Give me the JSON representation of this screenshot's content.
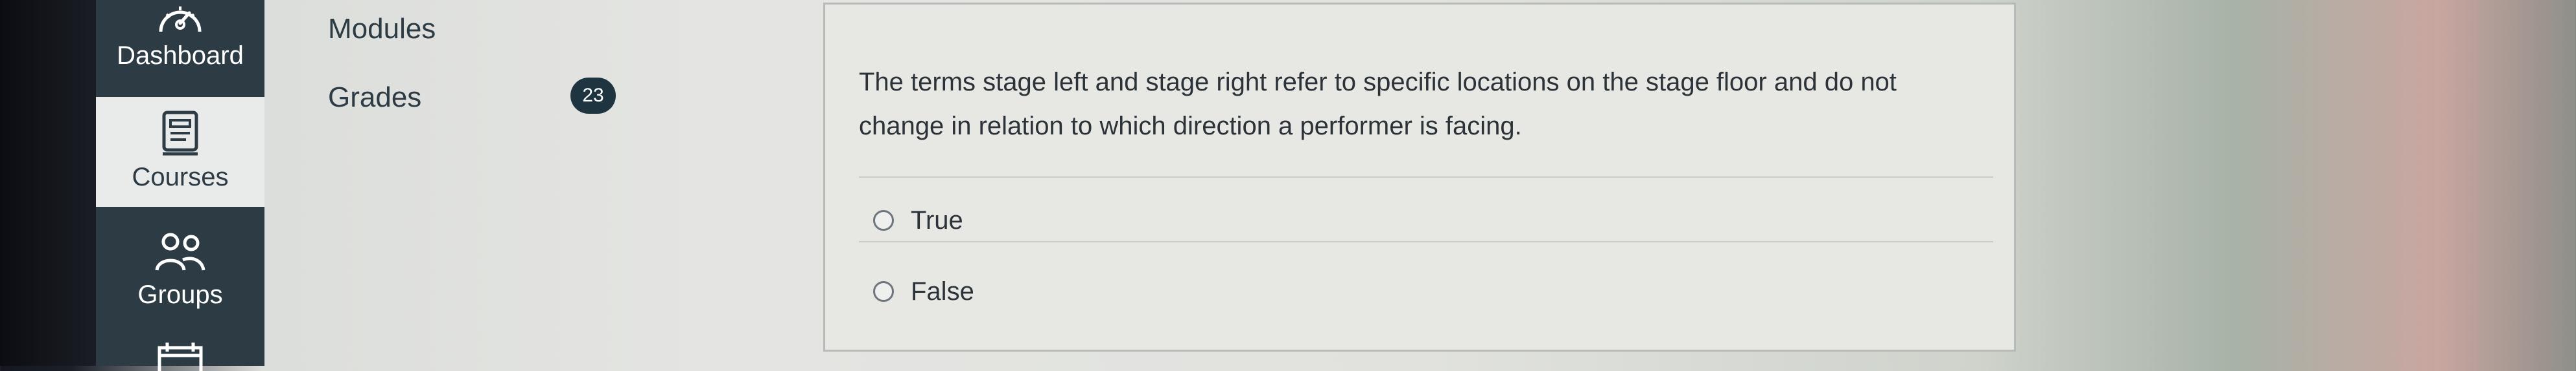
{
  "nav": {
    "items": [
      {
        "label": "Dashboard",
        "icon": "dashboard-icon"
      },
      {
        "label": "Courses",
        "icon": "courses-icon"
      },
      {
        "label": "Groups",
        "icon": "groups-icon"
      },
      {
        "label": "",
        "icon": "calendar-icon"
      }
    ],
    "active_index": 1
  },
  "course_menu": {
    "items": [
      {
        "label": "Modules"
      },
      {
        "label": "Grades",
        "badge": "23"
      }
    ]
  },
  "question": {
    "text": "The terms stage left and stage right refer to specific locations on the stage floor and do not change in relation to which direction a performer is facing.",
    "choices": [
      {
        "label": "True"
      },
      {
        "label": "False"
      }
    ]
  },
  "colors": {
    "nav_background": "#2d3b45",
    "active_nav_background": "#e9ebea",
    "badge_background": "#1f3441"
  }
}
